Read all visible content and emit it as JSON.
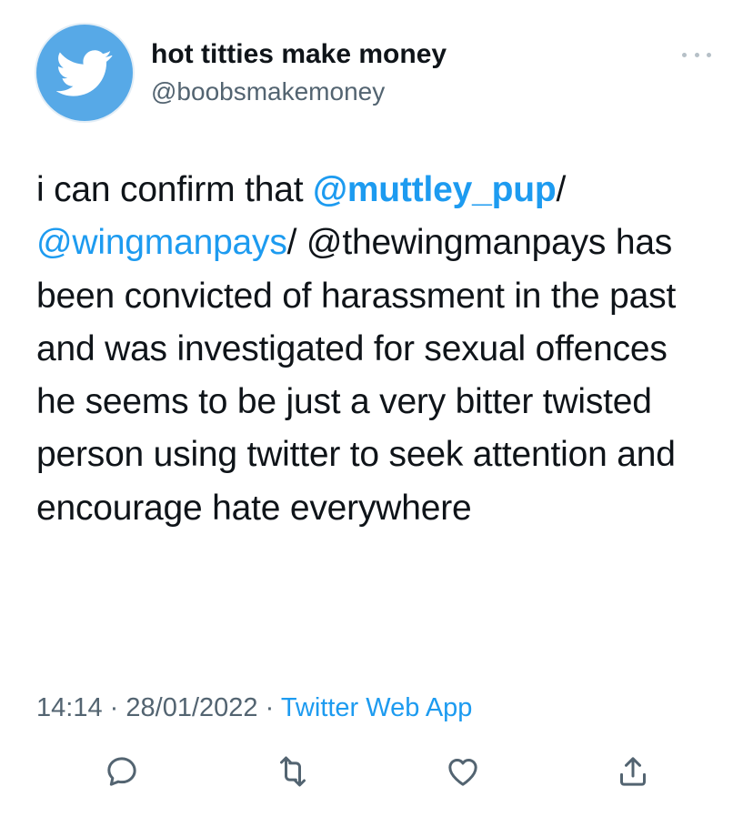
{
  "user": {
    "display_name": "hot titties make money",
    "handle": "@boobsmakemoney",
    "avatar_icon": "twitter-bird-icon"
  },
  "tweet": {
    "segments": [
      {
        "text": "i can confirm that ",
        "type": "text"
      },
      {
        "text": "@muttley_pup",
        "type": "mention-bold"
      },
      {
        "text": "/ ",
        "type": "text"
      },
      {
        "text": "@wingmanpays",
        "type": "mention"
      },
      {
        "text": "/ @thewingmanpays has been convicted of harassment in the past and was investigated for sexual offences",
        "type": "text"
      },
      {
        "text": "he seems to be just a very bitter twisted person using twitter to seek attention and encourage hate everywhere",
        "type": "text",
        "newline_before": true
      }
    ]
  },
  "meta": {
    "time": "14:14",
    "date": "28/01/2022",
    "separator": "·",
    "source": "Twitter Web App"
  },
  "actions": [
    {
      "name": "reply",
      "icon": "reply-icon"
    },
    {
      "name": "retweet",
      "icon": "retweet-icon"
    },
    {
      "name": "like",
      "icon": "heart-icon"
    },
    {
      "name": "share",
      "icon": "share-icon"
    }
  ],
  "colors": {
    "accent": "#1d9bf0",
    "avatar_bg": "#57a9e7",
    "secondary_text": "#536471",
    "primary_text": "#0f1419"
  }
}
